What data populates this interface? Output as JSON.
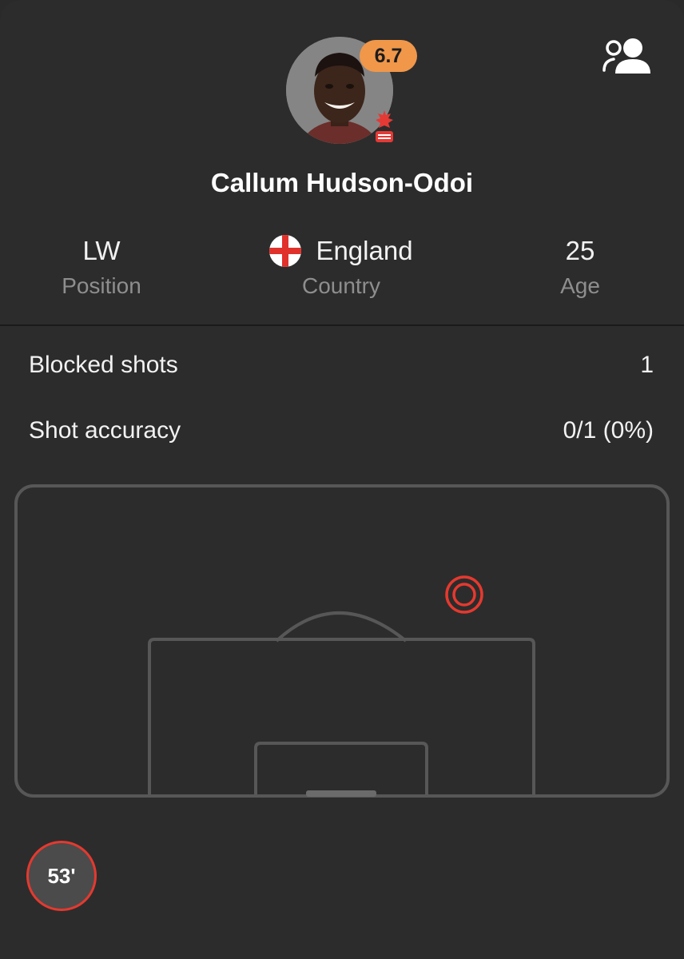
{
  "player": {
    "name": "Callum Hudson-Odoi",
    "rating": "6.7",
    "avatar": "player-photo",
    "club_crest": "nottingham-forest-crest"
  },
  "header": {
    "compare_icon": "compare-players-icon"
  },
  "info": {
    "position": {
      "value": "LW",
      "label": "Position"
    },
    "country": {
      "value": "England",
      "label": "Country",
      "flag": "england-flag-icon"
    },
    "age": {
      "value": "25",
      "label": "Age"
    }
  },
  "stats": [
    {
      "label": "Blocked shots",
      "value": "1"
    },
    {
      "label": "Shot accuracy",
      "value": "0/1 (0%)"
    }
  ],
  "shot_map": {
    "shots": [
      {
        "type": "blocked",
        "color": "#e5392f"
      }
    ]
  },
  "timeline": {
    "minute": "53'"
  },
  "colors": {
    "background": "#2c2c2c",
    "rating": "#f0974a",
    "shot": "#e5392f",
    "pitch_lines": "#555555"
  }
}
